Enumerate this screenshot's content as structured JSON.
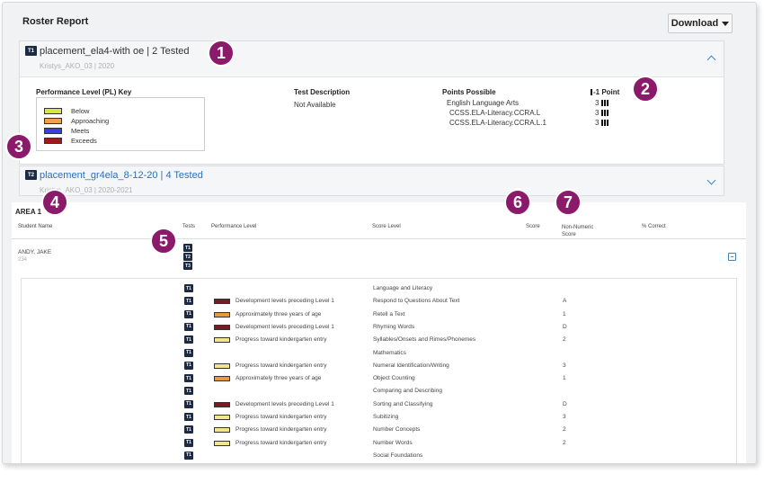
{
  "header": {
    "title": "Roster Report",
    "download_label": "Download"
  },
  "card1": {
    "badge": "T1",
    "title": "placement_ela4-with  oe | 2 Tested",
    "subtitle": "Kristys_AKO_03  |  2020",
    "pl_key": {
      "title": "Performance Level (PL) Key",
      "levels": [
        {
          "label": "Below",
          "color": "#d8e542"
        },
        {
          "label": "Approaching",
          "color": "#f2a14a"
        },
        {
          "label": "Meets",
          "color": "#3a3fe0"
        },
        {
          "label": "Exceeds",
          "color": "#a11a1a"
        }
      ]
    },
    "test_description": {
      "heading": "Test Description",
      "value": "Not Available"
    },
    "points_possible": {
      "heading": "Points Possible",
      "point_legend": "-1 Point",
      "rows": [
        {
          "label": "English Language Arts",
          "value": "3"
        },
        {
          "label": "CCSS.ELA-Literacy.CCRA.L",
          "value": "3"
        },
        {
          "label": "CCSS.ELA-Literacy.CCRA.L.1",
          "value": "3"
        }
      ]
    }
  },
  "card2": {
    "badge": "T2",
    "title": "placement_gr4ela_8-12-20 | 4 Tested",
    "subtitle": "Kristys_AKO_03  |  2020-2021"
  },
  "table": {
    "area_label": "AREA 1",
    "headers": {
      "student_name": "Student Name",
      "tests": "Tests",
      "performance_level": "Performance Level",
      "score_level": "Score Level",
      "score": "Score",
      "non_numeric": "Non-Numeric Score",
      "percent_correct": "% Correct"
    },
    "student": {
      "name": "ANDY, JAKE",
      "id": "234",
      "tests": [
        "T1",
        "T2",
        "T3"
      ]
    },
    "rows": [
      {
        "badge": "T1",
        "pl": "",
        "pl_color": "",
        "score_level": "Language and Literacy",
        "nn": ""
      },
      {
        "badge": "T1",
        "pl": "Development levels preceding Level 1",
        "pl_color": "#7a1a22",
        "score_level": "Respond to Questions About Text",
        "nn": "A"
      },
      {
        "badge": "T1",
        "pl": "Approximately three years of age",
        "pl_color": "#e89a3a",
        "score_level": "Retell a Text",
        "nn": "1"
      },
      {
        "badge": "T1",
        "pl": "Development levels preceding Level 1",
        "pl_color": "#7a1a22",
        "score_level": "Rhyming Words",
        "nn": "D"
      },
      {
        "badge": "T1",
        "pl": "Progress toward kindergarten entry",
        "pl_color": "#f3e58a",
        "score_level": "Syllables/Onsets and Rimes/Phonemes",
        "nn": "2"
      },
      {
        "badge": "T1",
        "pl": "",
        "pl_color": "",
        "score_level": "Mathematics",
        "nn": ""
      },
      {
        "badge": "T1",
        "pl": "Progress toward kindergarten entry",
        "pl_color": "#f3e58a",
        "score_level": "Numeral Identification/Writing",
        "nn": "3"
      },
      {
        "badge": "T1",
        "pl": "Approximately three years of age",
        "pl_color": "#e89a3a",
        "score_level": "Object Counting",
        "nn": "1"
      },
      {
        "badge": "T1",
        "pl": "",
        "pl_color": "",
        "score_level": "Comparing and Describing",
        "nn": ""
      },
      {
        "badge": "T1",
        "pl": "Development levels preceding Level 1",
        "pl_color": "#7a1a22",
        "score_level": "Sorting and Classifying",
        "nn": "D"
      },
      {
        "badge": "T1",
        "pl": "Progress toward kindergarten entry",
        "pl_color": "#f3e58a",
        "score_level": "Subitizing",
        "nn": "3"
      },
      {
        "badge": "T1",
        "pl": "Progress toward kindergarten entry",
        "pl_color": "#f3e58a",
        "score_level": "Number Concepts",
        "nn": "2"
      },
      {
        "badge": "T1",
        "pl": "Progress toward kindergarten entry",
        "pl_color": "#f3e58a",
        "score_level": "Number Words",
        "nn": "2"
      },
      {
        "badge": "T1",
        "pl": "",
        "pl_color": "",
        "score_level": "Social Foundations",
        "nn": ""
      },
      {
        "badge": "T1",
        "pl": "",
        "pl_color": "#e89a3a",
        "score_level": "",
        "nn": ""
      }
    ]
  },
  "callouts": [
    "1",
    "2",
    "3",
    "4",
    "5",
    "6",
    "7"
  ]
}
